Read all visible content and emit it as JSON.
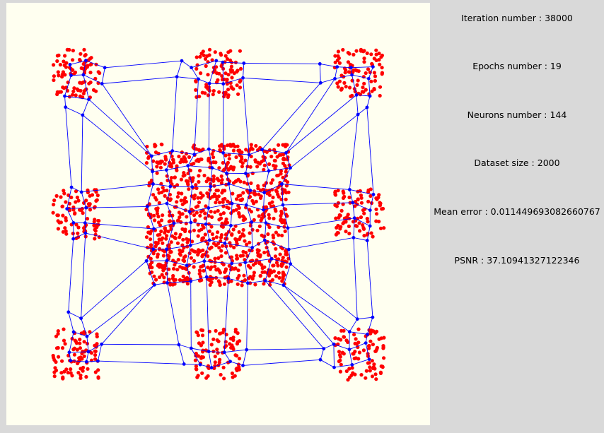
{
  "stats": {
    "iteration": "Iteration number : 38000",
    "epochs": "Epochs number : 19",
    "neurons": "Neurons number : 144",
    "dataset": "Dataset size : 2000",
    "mean_error": "Mean error : 0.011449693082660767",
    "psnr": "PSNR : 37.10941327122346"
  },
  "colors": {
    "background": "#fffff0",
    "data_point": "#ff0000",
    "neuron": "#0000ff",
    "edge": "#0000ff"
  }
}
